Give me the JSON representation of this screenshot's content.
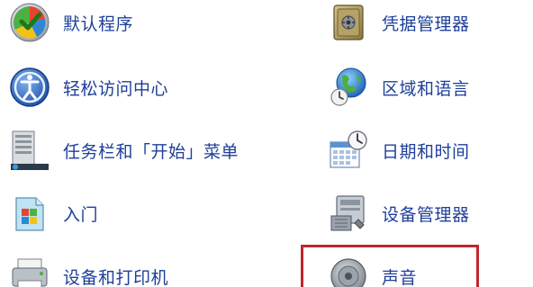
{
  "control_panel": {
    "left_column": [
      {
        "label": "默认程序",
        "icon": "default-programs-icon"
      },
      {
        "label": "轻松访问中心",
        "icon": "ease-of-access-icon"
      },
      {
        "label": "任务栏和「开始」菜单",
        "icon": "taskbar-start-menu-icon"
      },
      {
        "label": "入门",
        "icon": "getting-started-icon"
      },
      {
        "label": "设备和打印机",
        "icon": "devices-printers-icon"
      }
    ],
    "right_column": [
      {
        "label": "凭据管理器",
        "icon": "credential-manager-icon"
      },
      {
        "label": "区域和语言",
        "icon": "region-language-icon"
      },
      {
        "label": "日期和时间",
        "icon": "date-time-icon"
      },
      {
        "label": "设备管理器",
        "icon": "device-manager-icon"
      },
      {
        "label": "声音",
        "icon": "sound-icon"
      }
    ],
    "highlighted_item": "声音",
    "colors": {
      "link_text": "#1e3f9a",
      "highlight_border": "#c0262c"
    }
  }
}
